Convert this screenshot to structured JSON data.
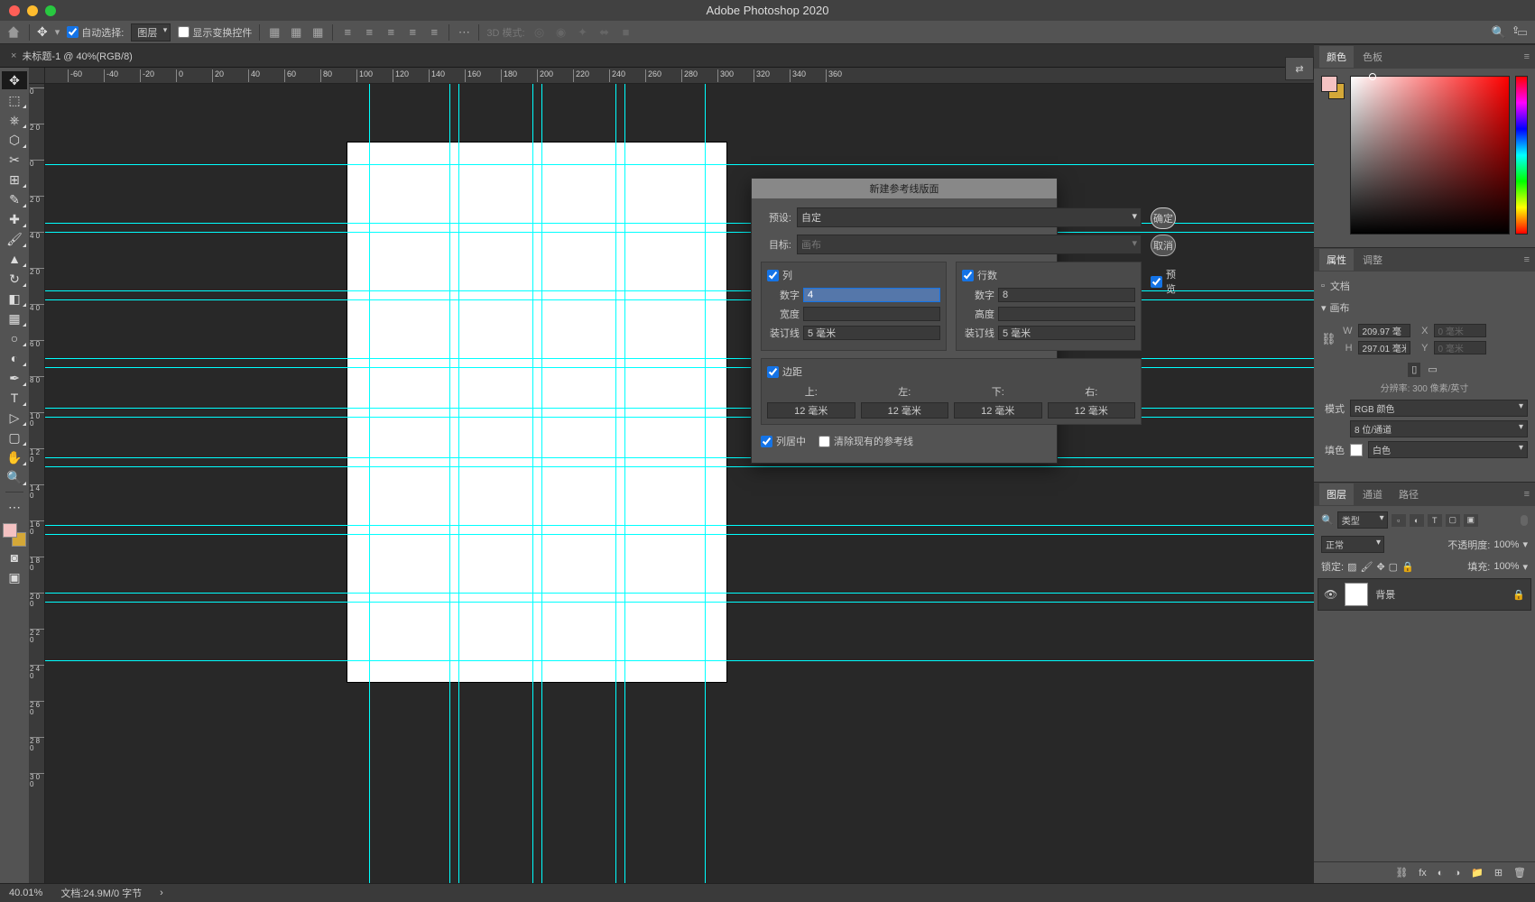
{
  "app_title": "Adobe Photoshop 2020",
  "options": {
    "auto_select": "自动选择:",
    "auto_select_target": "图层",
    "show_transform": "显示变换控件",
    "mode_3d_label": "3D 模式:"
  },
  "document": {
    "tab_title": "未标题-1 @ 40%(RGB/8)"
  },
  "ruler_h": [
    "-60",
    "-40",
    "-20",
    "0",
    "20",
    "40",
    "60",
    "80",
    "100",
    "120",
    "140",
    "160",
    "180",
    "200",
    "220",
    "240",
    "260",
    "280",
    "300",
    "320",
    "340",
    "360"
  ],
  "ruler_v": [
    "0",
    "20",
    "0",
    "20",
    "40",
    "20",
    "40",
    "60",
    "80",
    "100",
    "120",
    "140",
    "160",
    "180",
    "200",
    "220",
    "240",
    "260",
    "280",
    "300"
  ],
  "dialog": {
    "title": "新建参考线版面",
    "preset_label": "预设:",
    "preset_value": "自定",
    "target_label": "目标:",
    "target_value": "画布",
    "cols": {
      "checkbox": "列",
      "number_label": "数字",
      "number_value": "4",
      "width_label": "宽度",
      "width_value": "",
      "gutter_label": "装订线",
      "gutter_value": "5 毫米"
    },
    "rows": {
      "checkbox": "行数",
      "number_label": "数字",
      "number_value": "8",
      "height_label": "高度",
      "height_value": "",
      "gutter_label": "装订线",
      "gutter_value": "5 毫米"
    },
    "margin": {
      "checkbox": "边距",
      "top_label": "上:",
      "left_label": "左:",
      "bottom_label": "下:",
      "right_label": "右:",
      "top": "12 毫米",
      "left": "12 毫米",
      "bottom": "12 毫米",
      "right": "12 毫米"
    },
    "center_cols": "列居中",
    "clear_existing": "清除现有的参考线",
    "ok": "确定",
    "cancel": "取消",
    "preview": "预览"
  },
  "panels": {
    "color_tab": "颜色",
    "swatches_tab": "色板",
    "properties_tab": "属性",
    "adjustments_tab": "调整",
    "properties": {
      "doc_label": "文档",
      "canvas_label": "画布",
      "w_label": "W",
      "w_value": "209.97 毫",
      "x_label": "X",
      "x_value": "0 毫米",
      "h_label": "H",
      "h_value": "297.01 毫米",
      "y_label": "Y",
      "y_value": "0 毫米",
      "resolution": "分辨率: 300 像素/英寸",
      "mode_label": "模式",
      "mode_value": "RGB 颜色",
      "bits_value": "8 位/通道",
      "fill_label": "填色",
      "fill_value": "白色"
    },
    "layers_tab": "图层",
    "channels_tab": "通道",
    "paths_tab": "路径",
    "layers": {
      "kind": "类型",
      "blend": "正常",
      "opacity_label": "不透明度:",
      "opacity_value": "100%",
      "lock_label": "锁定:",
      "fill_label": "填充:",
      "fill_value": "100%",
      "bg_layer": "背景"
    }
  },
  "status": {
    "zoom": "40.01%",
    "doc_info": "文档:24.9M/0 字节"
  }
}
